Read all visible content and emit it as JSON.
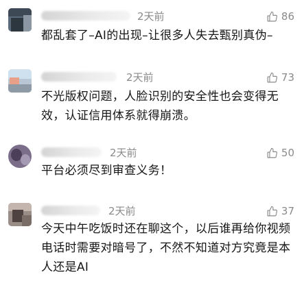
{
  "comments": [
    {
      "time": "2天前",
      "likes": "86",
      "text": "都乱套了–AI的出现–让很多人失去甄别真伪–"
    },
    {
      "time": "2天前",
      "likes": "73",
      "text": "不光版权问题，人脸识别的安全性也会变得无效，认证信用体系就得崩溃。"
    },
    {
      "time": "2天前",
      "likes": "50",
      "text": "平台必须尽到审查义务！"
    },
    {
      "time": "2天前",
      "likes": "37",
      "text": "今天中午吃饭时还在聊这个，以后谁再给你视频电话时需要对暗号了，不然不知道对方究竟是本人还是AI"
    }
  ],
  "icons": {
    "like": "thumbs-up-icon"
  },
  "colors": {
    "meta": "#8a8a8a",
    "text": "#161616"
  }
}
